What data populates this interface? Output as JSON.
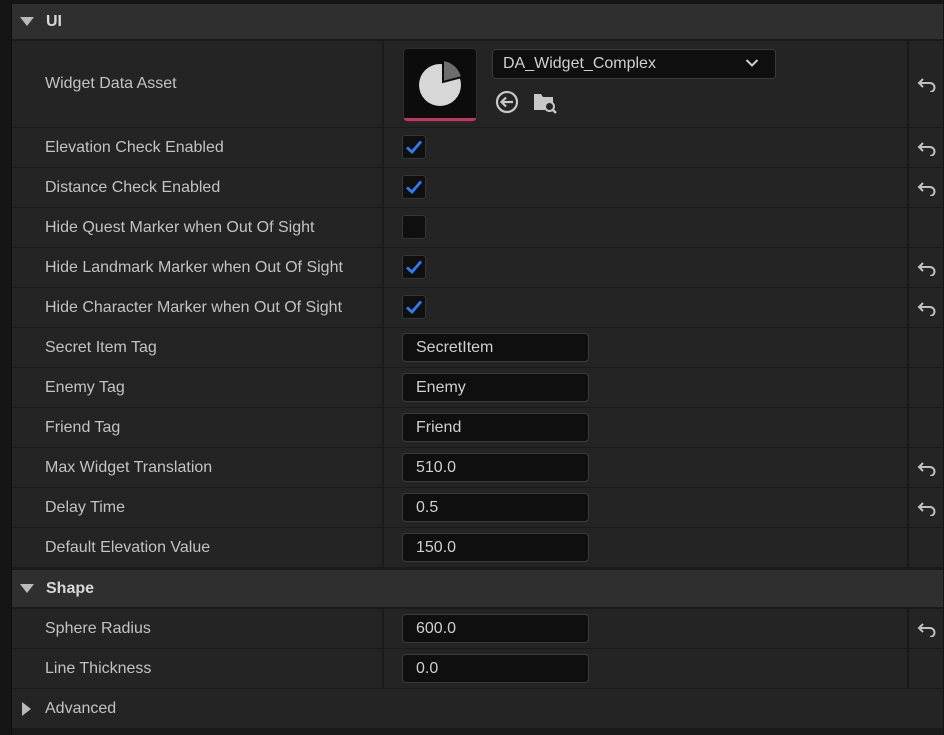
{
  "sections": {
    "ui": {
      "title": "UI",
      "widget_data_asset": {
        "label": "Widget Data Asset",
        "value": "DA_Widget_Complex"
      },
      "elevation_check": {
        "label": "Elevation Check Enabled",
        "checked": true
      },
      "distance_check": {
        "label": "Distance Check Enabled",
        "checked": true
      },
      "hide_quest": {
        "label": "Hide Quest Marker when Out Of Sight",
        "checked": false
      },
      "hide_landmark": {
        "label": "Hide Landmark Marker when Out Of Sight",
        "checked": true
      },
      "hide_character": {
        "label": "Hide Character Marker when Out Of Sight",
        "checked": true
      },
      "secret_item_tag": {
        "label": "Secret Item Tag",
        "value": "SecretItem"
      },
      "enemy_tag": {
        "label": "Enemy Tag",
        "value": "Enemy"
      },
      "friend_tag": {
        "label": "Friend Tag",
        "value": "Friend"
      },
      "max_widget_translation": {
        "label": "Max Widget Translation",
        "value": "510.0"
      },
      "delay_time": {
        "label": "Delay Time",
        "value": "0.5"
      },
      "default_elevation": {
        "label": "Default Elevation Value",
        "value": "150.0"
      }
    },
    "shape": {
      "title": "Shape",
      "sphere_radius": {
        "label": "Sphere Radius",
        "value": "600.0"
      },
      "line_thickness": {
        "label": "Line Thickness",
        "value": "0.0"
      }
    },
    "advanced": {
      "title": "Advanced"
    }
  },
  "colors": {
    "accent_check": "#2f7cf4",
    "asset_bar": "#c43562",
    "panel_bg": "#242424",
    "header_bg": "#2f2f2f"
  },
  "icons": {
    "expand": "caret-down-icon",
    "collapse": "caret-right-icon",
    "reset": "reset-arrow-icon",
    "use_selected": "use-selected-asset-icon",
    "browse": "browse-folder-icon",
    "combo": "chevron-down-icon"
  }
}
